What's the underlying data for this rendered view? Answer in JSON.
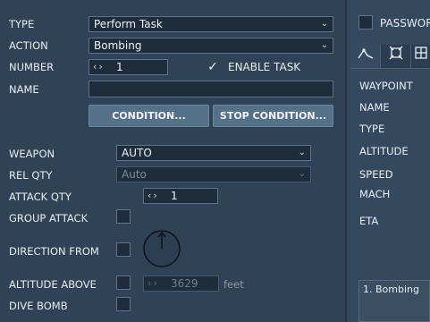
{
  "form": {
    "type_label": "TYPE",
    "type_value": "Perform Task",
    "action_label": "ACTION",
    "action_value": "Bombing",
    "number_label": "NUMBER",
    "number_value": "1",
    "enable_task_label": "ENABLE TASK",
    "enable_task_checked": true,
    "name_label": "NAME",
    "name_value": "",
    "condition_button": "CONDITION...",
    "stop_condition_button": "STOP CONDITION...",
    "weapon_label": "WEAPON",
    "weapon_value": "AUTO",
    "rel_qty_label": "REL QTY",
    "rel_qty_value": "Auto",
    "attack_qty_label": "ATTACK QTY",
    "attack_qty_value": "1",
    "group_attack_label": "GROUP ATTACK",
    "direction_from_label": "DIRECTION FROM",
    "altitude_above_label": "ALTITUDE ABOVE",
    "altitude_above_value": "3629",
    "altitude_unit": "feet",
    "dive_bomb_label": "DIVE BOMB"
  },
  "right_panel": {
    "password_label": "PASSWOR",
    "tabs": [
      {
        "icon": "waypoint-path-icon",
        "active": true
      },
      {
        "icon": "target-icon",
        "active": false
      },
      {
        "icon": "grid-icon",
        "active": false
      }
    ],
    "labels": {
      "waypoint": "WAYPOINT",
      "name": "NAME",
      "type": "TYPE",
      "altitude": "ALTITUDE",
      "speed": "SPEED",
      "mach": "MACH",
      "eta": "ETA"
    },
    "task_list": [
      "1. Bombing"
    ]
  },
  "colors": {
    "background": "#2f4256",
    "field_bg": "#1e2d3c",
    "button_bg": "#557089"
  }
}
